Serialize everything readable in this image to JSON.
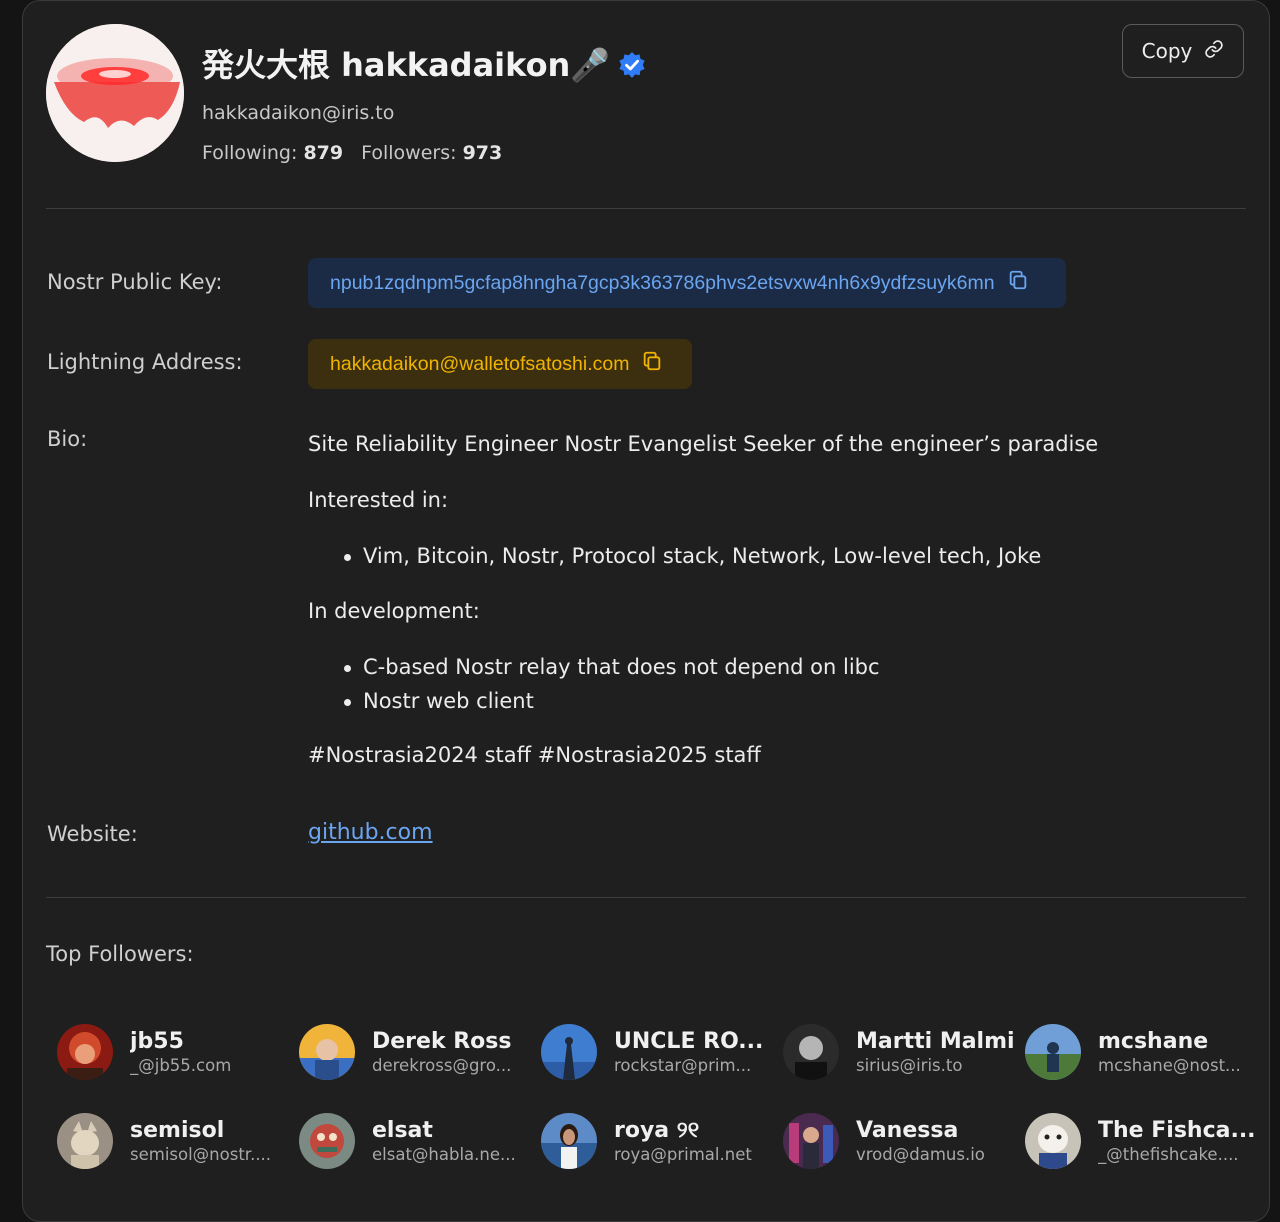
{
  "profile": {
    "display_name": "発火大根 hakkadaikon🎤",
    "nip05": "hakkadaikon@iris.to",
    "following_label": "Following:",
    "following_count": "879",
    "followers_label": "Followers:",
    "followers_count": "973",
    "verified_icon": "verified-badge-icon"
  },
  "toolbar": {
    "copy_label": "Copy",
    "copy_icon": "link-icon"
  },
  "fields": {
    "pubkey_label": "Nostr Public Key:",
    "pubkey_value": "npub1zqdnpm5gcfap8hngha7gcp3k363786phvs2etsvxw4nh6x9ydfzsuyk6mn",
    "lightning_label": "Lightning Address:",
    "lightning_value": "hakkadaikon@walletofsatoshi.com",
    "bio_label": "Bio:",
    "website_label": "Website:",
    "website_value": "github.com"
  },
  "bio": {
    "line1": "Site Reliability Engineer Nostr Evangelist Seeker of the engineer’s paradise",
    "interested_heading": "Interested in:",
    "interested_items": [
      "Vim, Bitcoin, Nostr, Protocol stack, Network, Low-level tech, Joke"
    ],
    "dev_heading": "In development:",
    "dev_items": [
      "C-based Nostr relay that does not depend on libc",
      "Nostr web client"
    ],
    "tags": "#Nostrasia2024 staff #Nostrasia2025 staff"
  },
  "top_followers": {
    "title": "Top Followers:",
    "items": [
      {
        "name": "jb55",
        "handle": "_@jb55.com"
      },
      {
        "name": "Derek Ross",
        "handle": "derekross@gro..."
      },
      {
        "name": "UNCLE RO...",
        "handle": "rockstar@prim..."
      },
      {
        "name": "Martti Malmi",
        "handle": "sirius@iris.to"
      },
      {
        "name": "mcshane",
        "handle": "mcshane@nost..."
      },
      {
        "name": "semisol",
        "handle": "semisol@nostr...."
      },
      {
        "name": "elsat",
        "handle": "elsat@habla.ne..."
      },
      {
        "name": "roya ୨୧",
        "handle": "roya@primal.net"
      },
      {
        "name": "Vanessa",
        "handle": "vrod@damus.io"
      },
      {
        "name": "The Fishca...",
        "handle": "_@thefishcake...."
      }
    ]
  },
  "colors": {
    "accent_blue": "#6ba5f0",
    "lightning_gold": "#f0b400",
    "verified_blue": "#2f7cf6"
  }
}
